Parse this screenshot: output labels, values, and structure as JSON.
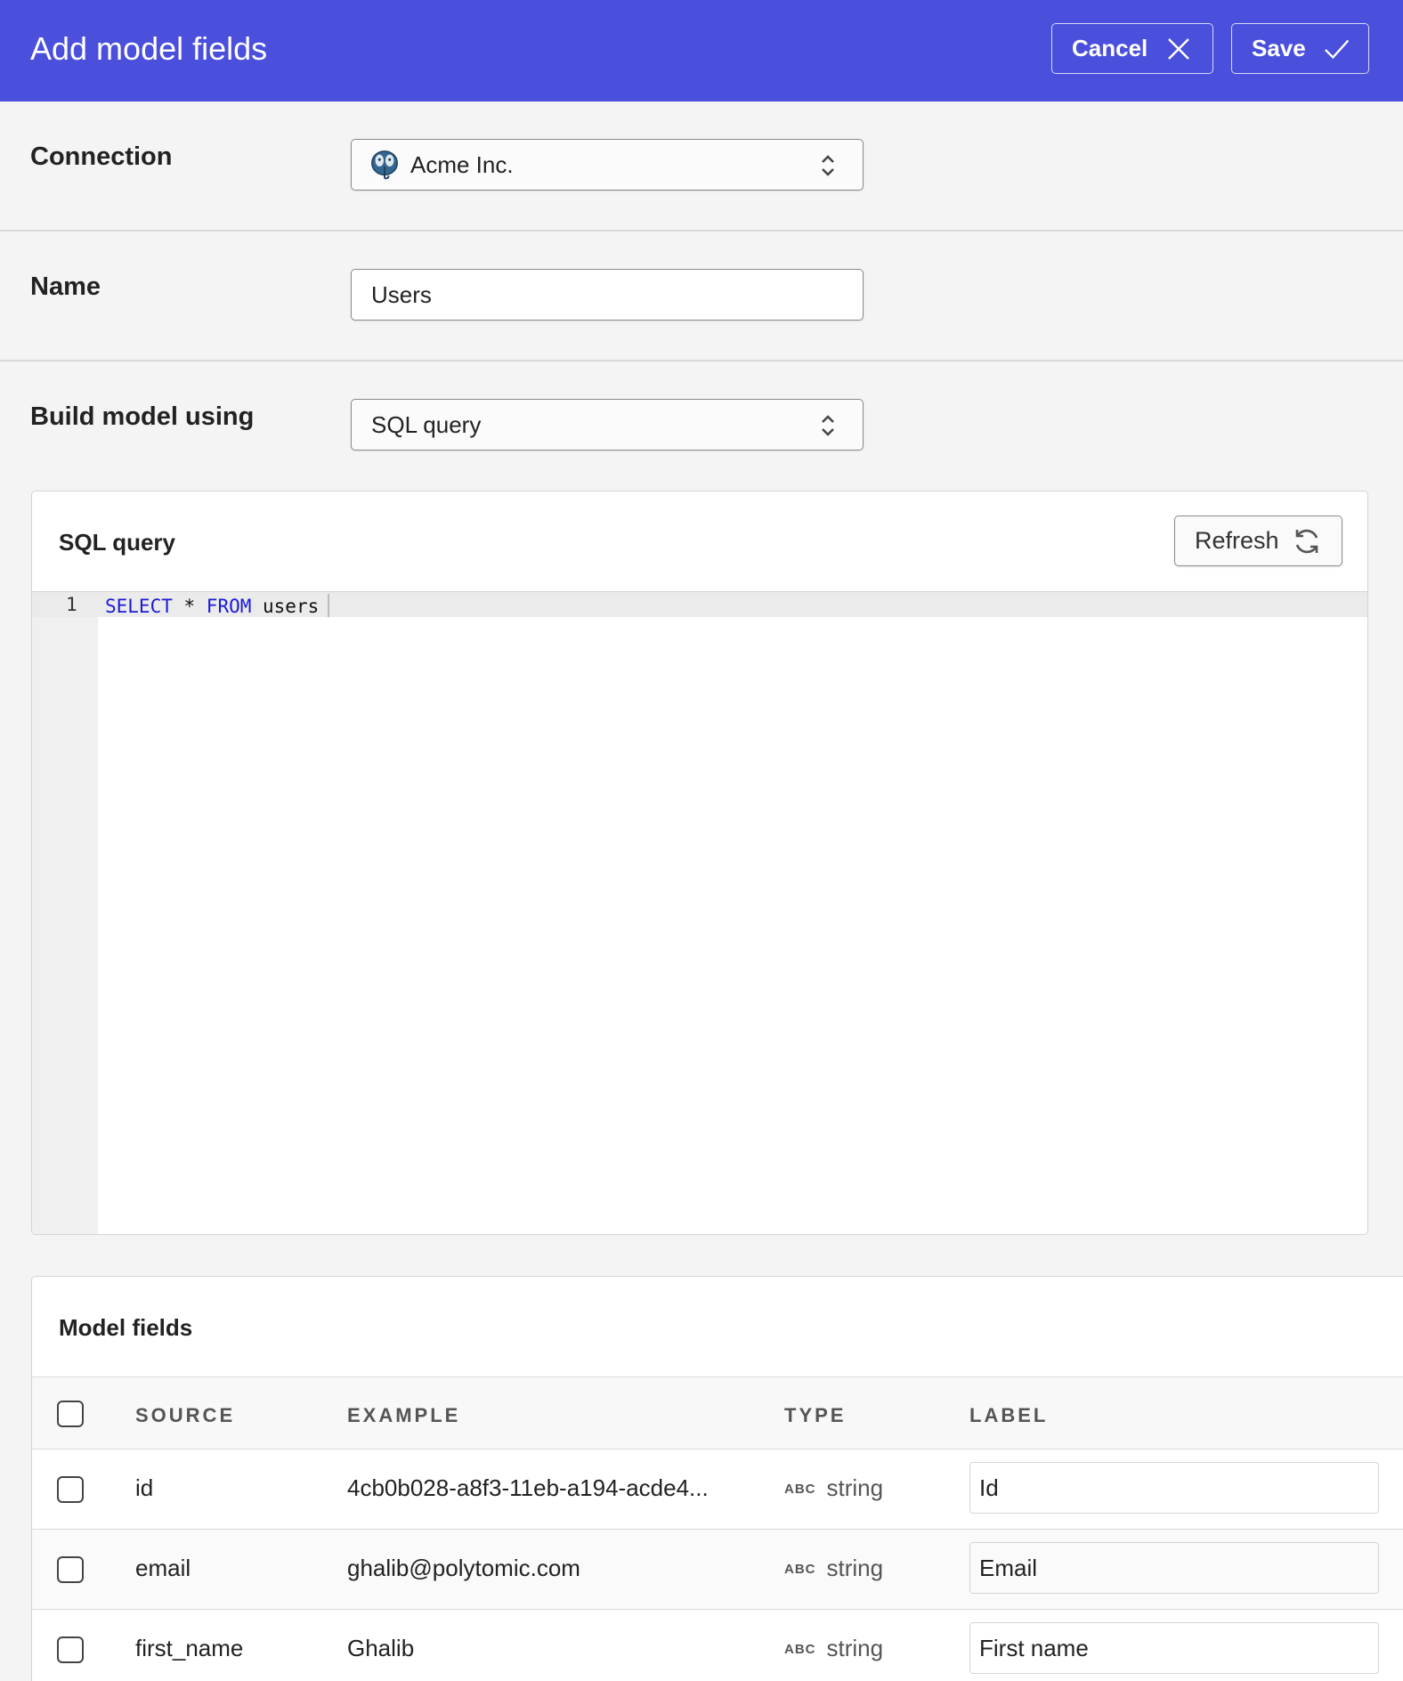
{
  "header": {
    "title": "Add model fields",
    "cancel_label": "Cancel",
    "save_label": "Save",
    "bg_color": "#4a4fdc"
  },
  "form": {
    "connection": {
      "label": "Connection",
      "value": "Acme Inc.",
      "icon": "postgresql-icon"
    },
    "name": {
      "label": "Name",
      "value": "Users"
    },
    "build": {
      "label": "Build model using",
      "value": "SQL query"
    }
  },
  "sql_panel": {
    "title": "SQL query",
    "refresh_label": "Refresh",
    "line_number": "1",
    "code": {
      "kw1": "SELECT",
      "op": " * ",
      "kw2": "FROM",
      "rest": " users"
    }
  },
  "model_fields": {
    "title": "Model fields",
    "columns": [
      "SOURCE",
      "EXAMPLE",
      "TYPE",
      "LABEL"
    ],
    "type_badge": "ABC",
    "rows": [
      {
        "source": "id",
        "example": "4cb0b028-a8f3-11eb-a194-acde4...",
        "type": "string",
        "label": "Id"
      },
      {
        "source": "email",
        "example": "ghalib@polytomic.com",
        "type": "string",
        "label": "Email"
      },
      {
        "source": "first_name",
        "example": "Ghalib",
        "type": "string",
        "label": "First name"
      }
    ]
  }
}
